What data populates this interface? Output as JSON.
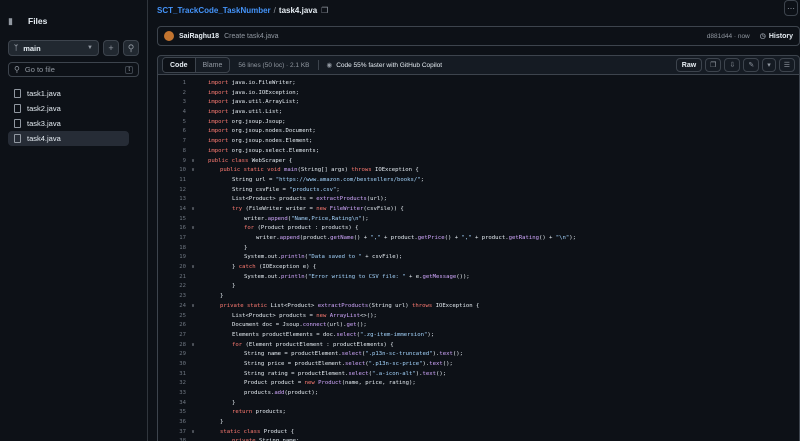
{
  "sidebar": {
    "title": "Files",
    "branch": "main",
    "search_placeholder": "Go to file",
    "search_shortcut": "t",
    "files": [
      "task1.java",
      "task2.java",
      "task3.java",
      "task4.java"
    ]
  },
  "breadcrumb": {
    "repo": "SCT_TrackCode_TaskNumber",
    "separator": "/",
    "file": "task4.java"
  },
  "commit": {
    "author": "SaiRaghu18",
    "message": "Create task4.java",
    "hash_time": "d881d44 · now",
    "history_label": "History"
  },
  "toolbar": {
    "code_tab": "Code",
    "blame_tab": "Blame",
    "lines_info": "56 lines (50 loc) · 2.1 KB",
    "copilot_text": "Code 55% faster with GitHub Copilot",
    "raw_label": "Raw"
  },
  "colors": {
    "background": "#0d1117",
    "link": "#4493f8",
    "keyword": "#ff7b72",
    "string": "#a5d6ff",
    "function": "#d2a8ff"
  },
  "code_lines": [
    {
      "n": "1",
      "fold": "",
      "indent": 0,
      "tokens": [
        [
          "k",
          "import "
        ],
        [
          "",
          "java.io.FileWriter;"
        ]
      ]
    },
    {
      "n": "2",
      "fold": "",
      "indent": 0,
      "tokens": [
        [
          "k",
          "import "
        ],
        [
          "",
          "java.io.IOException;"
        ]
      ]
    },
    {
      "n": "3",
      "fold": "",
      "indent": 0,
      "tokens": [
        [
          "k",
          "import "
        ],
        [
          "",
          "java.util.ArrayList;"
        ]
      ]
    },
    {
      "n": "4",
      "fold": "",
      "indent": 0,
      "tokens": [
        [
          "k",
          "import "
        ],
        [
          "",
          "java.util.List;"
        ]
      ]
    },
    {
      "n": "5",
      "fold": "",
      "indent": 0,
      "tokens": [
        [
          "k",
          "import "
        ],
        [
          "",
          "org.jsoup.Jsoup;"
        ]
      ]
    },
    {
      "n": "6",
      "fold": "",
      "indent": 0,
      "tokens": [
        [
          "k",
          "import "
        ],
        [
          "",
          "org.jsoup.nodes.Document;"
        ]
      ]
    },
    {
      "n": "7",
      "fold": "",
      "indent": 0,
      "tokens": [
        [
          "k",
          "import "
        ],
        [
          "",
          "org.jsoup.nodes.Element;"
        ]
      ]
    },
    {
      "n": "8",
      "fold": "",
      "indent": 0,
      "tokens": [
        [
          "k",
          "import "
        ],
        [
          "",
          "org.jsoup.select.Elements;"
        ]
      ]
    },
    {
      "n": "9",
      "fold": "v",
      "indent": 0,
      "tokens": [
        [
          "k",
          "public class "
        ],
        [
          "",
          "WebScraper {"
        ]
      ]
    },
    {
      "n": "10",
      "fold": "v",
      "indent": 1,
      "tokens": [
        [
          "k",
          "public static void "
        ],
        [
          "f",
          "main"
        ],
        [
          "",
          "(String[] args) "
        ],
        [
          "k",
          "throws "
        ],
        [
          "",
          "IOException {"
        ]
      ]
    },
    {
      "n": "11",
      "fold": "",
      "indent": 2,
      "tokens": [
        [
          "",
          "String url = "
        ],
        [
          "s",
          "\"https://www.amazon.com/bestsellers/books/\""
        ],
        [
          "",
          ";"
        ]
      ]
    },
    {
      "n": "12",
      "fold": "",
      "indent": 2,
      "tokens": [
        [
          "",
          "String csvFile = "
        ],
        [
          "s",
          "\"products.csv\""
        ],
        [
          "",
          ";"
        ]
      ]
    },
    {
      "n": "13",
      "fold": "",
      "indent": 2,
      "tokens": [
        [
          "",
          "List<Product> products = "
        ],
        [
          "f",
          "extractProducts"
        ],
        [
          "",
          "(url);"
        ]
      ]
    },
    {
      "n": "14",
      "fold": "v",
      "indent": 2,
      "tokens": [
        [
          "k",
          "try "
        ],
        [
          "",
          "(FileWriter writer = "
        ],
        [
          "k",
          "new "
        ],
        [
          "f",
          "FileWriter"
        ],
        [
          "",
          "(csvFile)) {"
        ]
      ]
    },
    {
      "n": "15",
      "fold": "",
      "indent": 3,
      "tokens": [
        [
          "",
          "writer."
        ],
        [
          "f",
          "append"
        ],
        [
          "",
          "("
        ],
        [
          "s",
          "\"Name,Price,Rating\\n\""
        ],
        [
          "",
          ");"
        ]
      ]
    },
    {
      "n": "16",
      "fold": "v",
      "indent": 3,
      "tokens": [
        [
          "k",
          "for "
        ],
        [
          "",
          "(Product product : products) {"
        ]
      ]
    },
    {
      "n": "17",
      "fold": "",
      "indent": 4,
      "tokens": [
        [
          "",
          "writer."
        ],
        [
          "f",
          "append"
        ],
        [
          "",
          "(product."
        ],
        [
          "f",
          "getName"
        ],
        [
          "",
          "() + "
        ],
        [
          "s",
          "\",\""
        ],
        [
          "",
          " + product."
        ],
        [
          "f",
          "getPrice"
        ],
        [
          "",
          "() + "
        ],
        [
          "s",
          "\",\""
        ],
        [
          "",
          " + product."
        ],
        [
          "f",
          "getRating"
        ],
        [
          "",
          "() + "
        ],
        [
          "s",
          "\"\\n\""
        ],
        [
          "",
          ");"
        ]
      ]
    },
    {
      "n": "18",
      "fold": "",
      "indent": 3,
      "tokens": [
        [
          "",
          "}"
        ]
      ]
    },
    {
      "n": "19",
      "fold": "",
      "indent": 3,
      "tokens": [
        [
          "",
          "System.out."
        ],
        [
          "f",
          "println"
        ],
        [
          "",
          "("
        ],
        [
          "s",
          "\"Data saved to \""
        ],
        [
          "",
          " + csvFile);"
        ]
      ]
    },
    {
      "n": "20",
      "fold": "v",
      "indent": 2,
      "tokens": [
        [
          "",
          "} "
        ],
        [
          "k",
          "catch "
        ],
        [
          "",
          "(IOException e) {"
        ]
      ]
    },
    {
      "n": "21",
      "fold": "",
      "indent": 3,
      "tokens": [
        [
          "",
          "System.out."
        ],
        [
          "f",
          "println"
        ],
        [
          "",
          "("
        ],
        [
          "s",
          "\"Error writing to CSV file: \""
        ],
        [
          "",
          " + e."
        ],
        [
          "f",
          "getMessage"
        ],
        [
          "",
          "());"
        ]
      ]
    },
    {
      "n": "22",
      "fold": "",
      "indent": 2,
      "tokens": [
        [
          "",
          "}"
        ]
      ]
    },
    {
      "n": "23",
      "fold": "",
      "indent": 1,
      "tokens": [
        [
          "",
          "}"
        ]
      ]
    },
    {
      "n": "24",
      "fold": "v",
      "indent": 1,
      "tokens": [
        [
          "k",
          "private static "
        ],
        [
          "",
          "List<Product> "
        ],
        [
          "f",
          "extractProducts"
        ],
        [
          "",
          "(String url) "
        ],
        [
          "k",
          "throws "
        ],
        [
          "",
          "IOException {"
        ]
      ]
    },
    {
      "n": "25",
      "fold": "",
      "indent": 2,
      "tokens": [
        [
          "",
          "List<Product> products = "
        ],
        [
          "k",
          "new "
        ],
        [
          "f",
          "ArrayList"
        ],
        [
          "",
          "<>();"
        ]
      ]
    },
    {
      "n": "26",
      "fold": "",
      "indent": 2,
      "tokens": [
        [
          "",
          "Document doc = Jsoup."
        ],
        [
          "f",
          "connect"
        ],
        [
          "",
          "(url)."
        ],
        [
          "f",
          "get"
        ],
        [
          "",
          "();"
        ]
      ]
    },
    {
      "n": "27",
      "fold": "",
      "indent": 2,
      "tokens": [
        [
          "",
          "Elements productElements = doc."
        ],
        [
          "f",
          "select"
        ],
        [
          "",
          "("
        ],
        [
          "s",
          "\".zg-item-immersion\""
        ],
        [
          "",
          ");"
        ]
      ]
    },
    {
      "n": "28",
      "fold": "v",
      "indent": 2,
      "tokens": [
        [
          "k",
          "for "
        ],
        [
          "",
          "(Element productElement : productElements) {"
        ]
      ]
    },
    {
      "n": "29",
      "fold": "",
      "indent": 3,
      "tokens": [
        [
          "",
          "String name = productElement."
        ],
        [
          "f",
          "select"
        ],
        [
          "",
          "("
        ],
        [
          "s",
          "\".p13n-sc-truncated\""
        ],
        [
          "",
          ")."
        ],
        [
          "f",
          "text"
        ],
        [
          "",
          "();"
        ]
      ]
    },
    {
      "n": "30",
      "fold": "",
      "indent": 3,
      "tokens": [
        [
          "",
          "String price = productElement."
        ],
        [
          "f",
          "select"
        ],
        [
          "",
          "("
        ],
        [
          "s",
          "\".p13n-sc-price\""
        ],
        [
          "",
          ")."
        ],
        [
          "f",
          "text"
        ],
        [
          "",
          "();"
        ]
      ]
    },
    {
      "n": "31",
      "fold": "",
      "indent": 3,
      "tokens": [
        [
          "",
          "String rating = productElement."
        ],
        [
          "f",
          "select"
        ],
        [
          "",
          "("
        ],
        [
          "s",
          "\".a-icon-alt\""
        ],
        [
          "",
          ")."
        ],
        [
          "f",
          "text"
        ],
        [
          "",
          "();"
        ]
      ]
    },
    {
      "n": "32",
      "fold": "",
      "indent": 3,
      "tokens": [
        [
          "",
          "Product product = "
        ],
        [
          "k",
          "new "
        ],
        [
          "f",
          "Product"
        ],
        [
          "",
          "(name, price, rating);"
        ]
      ]
    },
    {
      "n": "33",
      "fold": "",
      "indent": 3,
      "tokens": [
        [
          "",
          "products."
        ],
        [
          "f",
          "add"
        ],
        [
          "",
          "(product);"
        ]
      ]
    },
    {
      "n": "34",
      "fold": "",
      "indent": 2,
      "tokens": [
        [
          "",
          "}"
        ]
      ]
    },
    {
      "n": "35",
      "fold": "",
      "indent": 2,
      "tokens": [
        [
          "k",
          "return "
        ],
        [
          "",
          "products;"
        ]
      ]
    },
    {
      "n": "36",
      "fold": "",
      "indent": 1,
      "tokens": [
        [
          "",
          "}"
        ]
      ]
    },
    {
      "n": "37",
      "fold": "v",
      "indent": 1,
      "tokens": [
        [
          "k",
          "static class "
        ],
        [
          "",
          "Product {"
        ]
      ]
    },
    {
      "n": "38",
      "fold": "",
      "indent": 2,
      "tokens": [
        [
          "k",
          "private "
        ],
        [
          "",
          "String name;"
        ]
      ]
    }
  ]
}
